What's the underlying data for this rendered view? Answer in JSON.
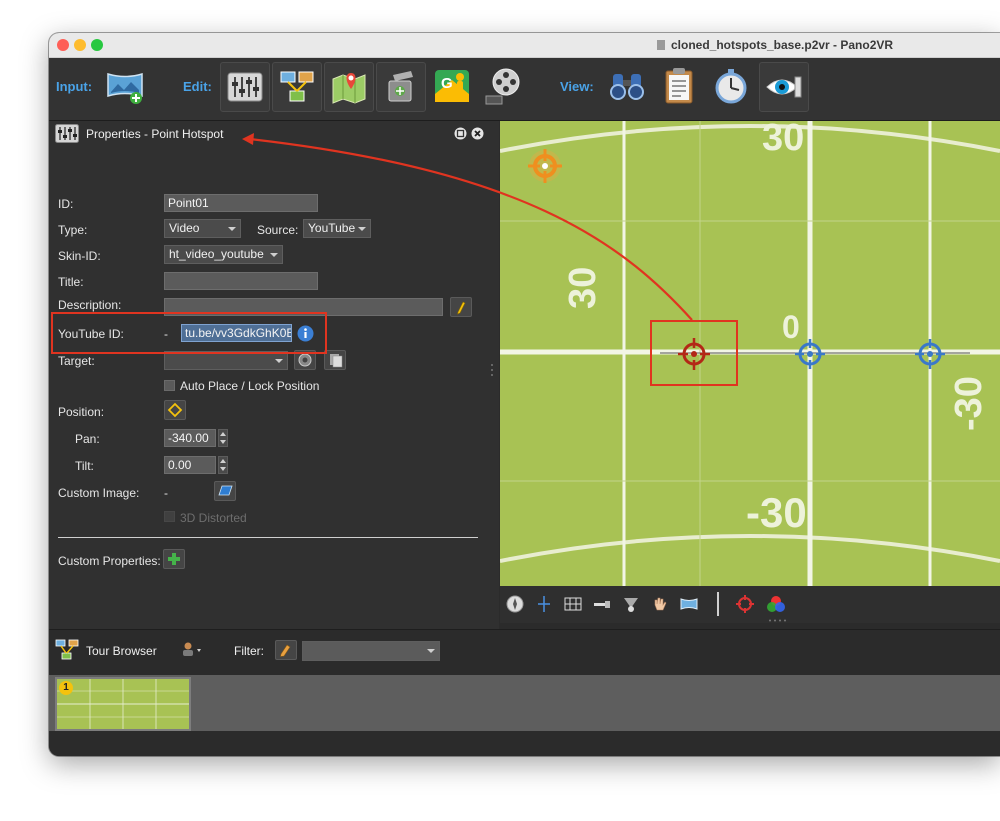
{
  "window": {
    "title": "cloned_hotspots_base.p2vr - Pano2VR"
  },
  "toolbar": {
    "input_label": "Input:",
    "edit_label": "Edit:",
    "view_label": "View:"
  },
  "properties": {
    "panel_title": "Properties - Point Hotspot",
    "id_label": "ID:",
    "id_value": "Point01",
    "type_label": "Type:",
    "type_value": "Video",
    "source_label": "Source:",
    "source_value": "YouTube",
    "skin_id_label": "Skin-ID:",
    "skin_id_value": "ht_video_youtube",
    "title_label": "Title:",
    "title_value": "",
    "description_label": "Description:",
    "description_value": "",
    "youtube_id_label": "YouTube ID:",
    "youtube_dash": "-",
    "youtube_id_value": "tu.be/vv3GdkGhK0E",
    "target_label": "Target:",
    "target_value": "",
    "auto_place_label": "Auto Place / Lock Position",
    "position_label": "Position:",
    "pan_label": "Pan:",
    "pan_value": "-340.00",
    "tilt_label": "Tilt:",
    "tilt_value": "0.00",
    "custom_image_label": "Custom Image:",
    "custom_image_value": "-",
    "distorted_label": "3D Distorted",
    "custom_properties_label": "Custom Properties:"
  },
  "viewer": {
    "labels": {
      "top": "30",
      "left": "30",
      "center": "0",
      "right": "-30",
      "bottom": "-30"
    }
  },
  "tour_browser": {
    "title": "Tour Browser",
    "filter_label": "Filter:",
    "filter_value": "",
    "thumb_badge": "1"
  },
  "colors": {
    "accent_blue": "#4aa3e8",
    "highlight_red": "#e03420",
    "grass": "#a8c254",
    "hotspot_blue": "#3a78c9",
    "hotspot_red": "#b32717"
  }
}
